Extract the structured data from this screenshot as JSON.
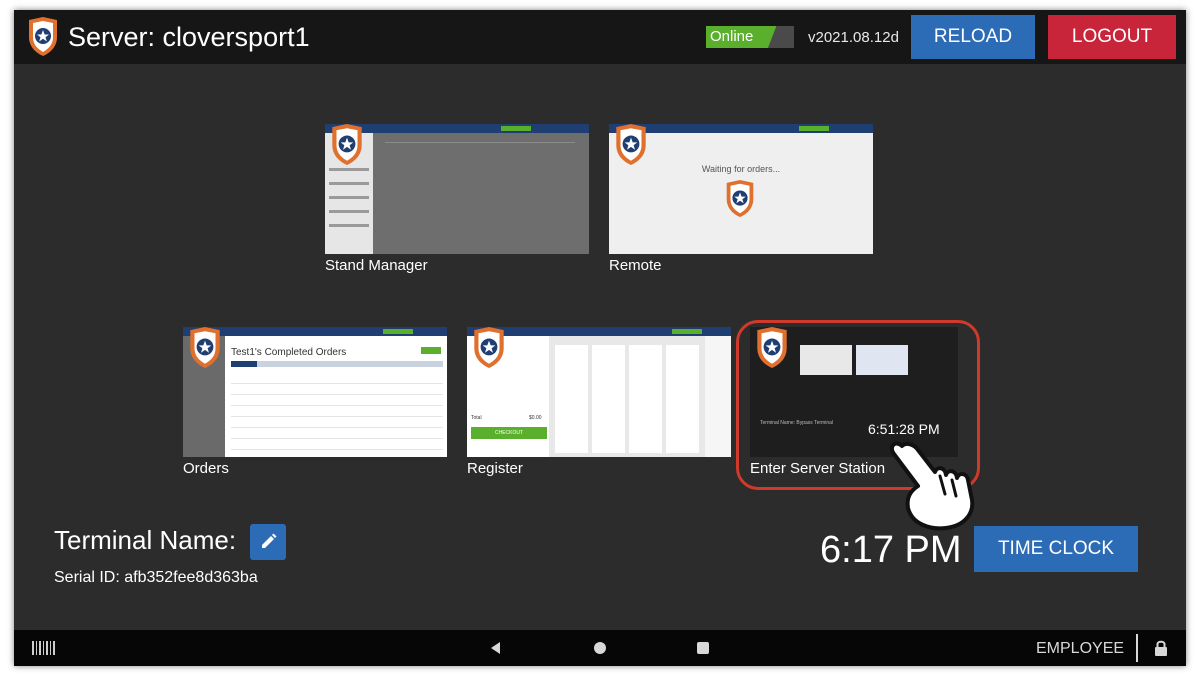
{
  "header": {
    "title": "Server: cloversport1",
    "status": {
      "label": "Online",
      "level_percent": 80
    },
    "version": "v2021.08.12d",
    "reload_label": "RELOAD",
    "logout_label": "LOGOUT"
  },
  "tiles": [
    {
      "label": "Stand Manager"
    },
    {
      "label": "Remote",
      "waiting_text": "Waiting for orders..."
    },
    {
      "label": "Orders",
      "heading": "Test1's Completed Orders"
    },
    {
      "label": "Register",
      "checkout_label": "CHECKOUT",
      "total_label": "Total",
      "total_value": "$0.00"
    },
    {
      "label": "Enter Server Station",
      "time": "6:51:28 PM",
      "terminal_text": "Terminal Name: Bypass Terminal"
    }
  ],
  "terminal": {
    "name_label": "Terminal Name:",
    "serial": "Serial ID: afb352fee8d363ba"
  },
  "clock": {
    "time": "6:17 PM",
    "timeclock_label": "TIME CLOCK"
  },
  "navbar": {
    "user_label": "EMPLOYEE"
  },
  "colors": {
    "accent_blue": "#2c6bb5",
    "logout_red": "#c8243a",
    "online_green": "#5ab02c",
    "shield_orange": "#e0702e",
    "shield_navy": "#1f3f73",
    "highlight_red": "#d03a2a"
  },
  "icons": [
    "shield-star-icon",
    "pencil-icon",
    "barcode-icon",
    "back-icon",
    "home-icon",
    "recent-apps-icon",
    "lock-icon",
    "pointing-hand-icon"
  ]
}
